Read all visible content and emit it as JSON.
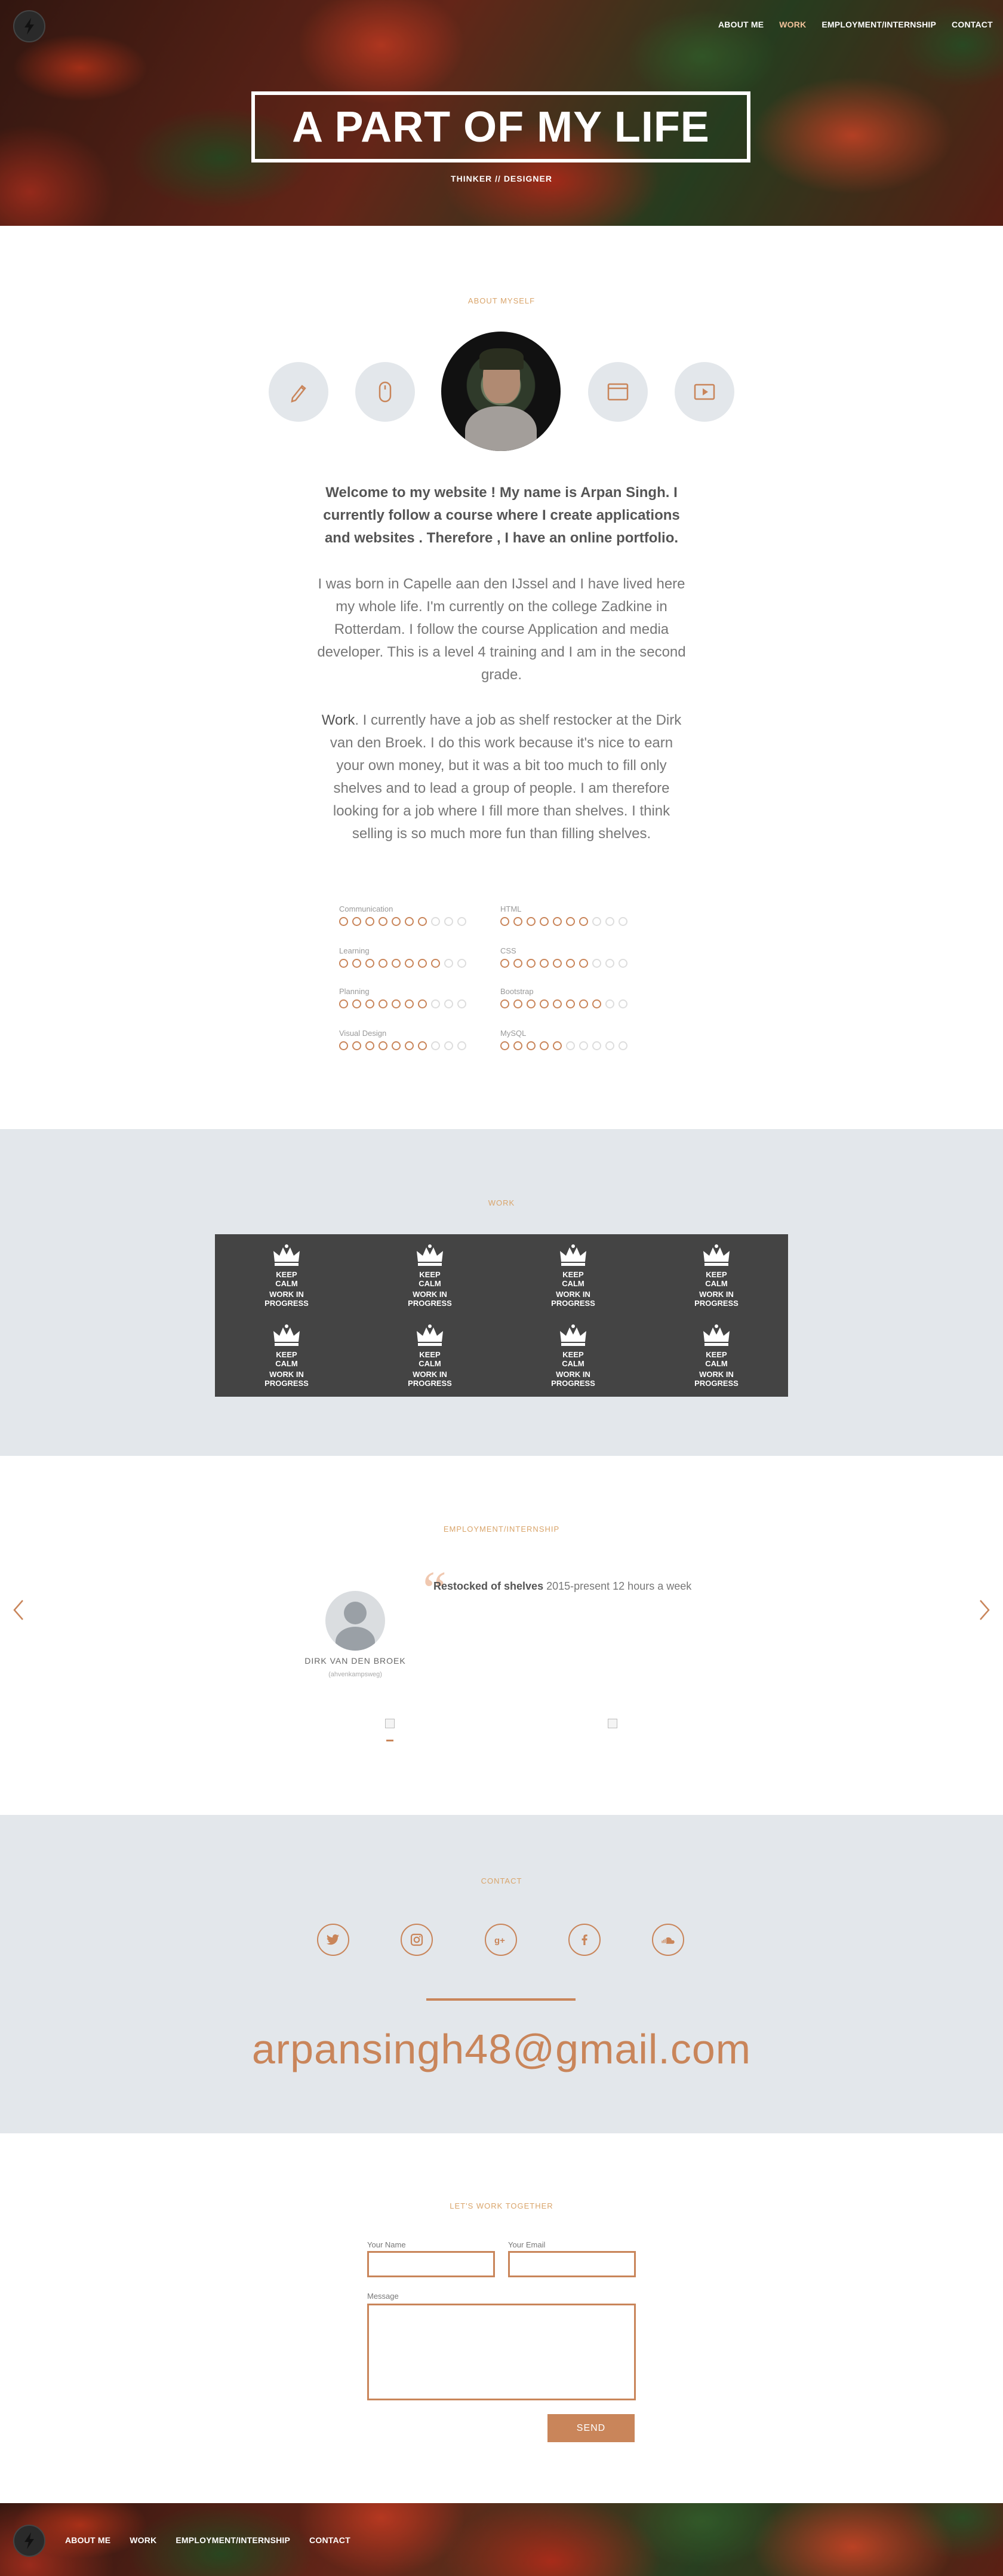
{
  "nav": {
    "items": [
      {
        "label": "ABOUT ME",
        "active": false
      },
      {
        "label": "WORK",
        "active": true
      },
      {
        "label": "EMPLOYMENT/INTERNSHIP",
        "active": false
      },
      {
        "label": "CONTACT",
        "active": false
      }
    ]
  },
  "footer_nav": {
    "items": [
      {
        "label": "ABOUT ME"
      },
      {
        "label": "WORK"
      },
      {
        "label": "EMPLOYMENT/INTERNSHIP"
      },
      {
        "label": "CONTACT"
      }
    ]
  },
  "hero": {
    "title": "A PART OF MY LIFE",
    "tagline": "THINKER // DESIGNER"
  },
  "about": {
    "section_title": "ABOUT MYSELF",
    "icons": [
      "pencil-icon",
      "mouse-icon",
      "browser-window-icon",
      "video-play-icon"
    ],
    "lead": "Welcome to my website ! My name is Arpan Singh. I currently follow a course where I create applications and websites . Therefore , I have an online portfolio.",
    "paragraph1": "I was born in Capelle aan den IJssel and I have lived here my whole life. I'm currently on the college Zadkine in Rotterdam. I follow the course Application and media developer. This is a level 4 training and I am in the second grade.",
    "paragraph2_bold": "Work",
    "paragraph2": ". I currently have a job as shelf restocker at the Dirk van den Broek. I do this work because it's nice to earn your own money, but it was a bit too much to fill only shelves and to lead a group of people. I am therefore looking for a job where I fill more than shelves. I think selling is so much more fun than filling shelves."
  },
  "skills": [
    {
      "name": "Communication",
      "level": 7,
      "max": 10
    },
    {
      "name": "HTML",
      "level": 7,
      "max": 10
    },
    {
      "name": "Learning",
      "level": 8,
      "max": 10
    },
    {
      "name": "CSS",
      "level": 7,
      "max": 10
    },
    {
      "name": "Planning",
      "level": 7,
      "max": 10
    },
    {
      "name": "Bootstrap",
      "level": 8,
      "max": 10
    },
    {
      "name": "Visual Design",
      "level": 7,
      "max": 10
    },
    {
      "name": "MySQL",
      "level": 5,
      "max": 10
    }
  ],
  "work": {
    "section_title": "WORK",
    "tiles": [
      {
        "line1": "KEEP",
        "line2": "CALM",
        "line3": "WORK IN",
        "line4": "PROGRESS"
      },
      {
        "line1": "KEEP",
        "line2": "CALM",
        "line3": "WORK IN",
        "line4": "PROGRESS"
      },
      {
        "line1": "KEEP",
        "line2": "CALM",
        "line3": "WORK IN",
        "line4": "PROGRESS"
      },
      {
        "line1": "KEEP",
        "line2": "CALM",
        "line3": "WORK IN",
        "line4": "PROGRESS"
      },
      {
        "line1": "KEEP",
        "line2": "CALM",
        "line3": "WORK IN",
        "line4": "PROGRESS"
      },
      {
        "line1": "KEEP",
        "line2": "CALM",
        "line3": "WORK IN",
        "line4": "PROGRESS"
      },
      {
        "line1": "KEEP",
        "line2": "CALM",
        "line3": "WORK IN",
        "line4": "PROGRESS"
      },
      {
        "line1": "KEEP",
        "line2": "CALM",
        "line3": "WORK IN",
        "line4": "PROGRESS"
      }
    ]
  },
  "employment": {
    "section_title": "EMPLOYMENT/INTERNSHIP",
    "quote_bold": "Restocked of shelves",
    "quote_rest": " 2015-present 12 hours a week",
    "name": "DIRK VAN DEN BROEK",
    "subtitle": "(ahvenkampsweg)"
  },
  "contact": {
    "section_title": "CONTACT",
    "socials": [
      "twitter-icon",
      "instagram-icon",
      "google-plus-icon",
      "facebook-icon",
      "soundcloud-icon"
    ],
    "email": "arpansingh48@gmail.com"
  },
  "form": {
    "section_title": "LET'S WORK TOGETHER",
    "name_label": "Your Name",
    "email_label": "Your Email",
    "message_label": "Message",
    "send_label": "SEND"
  },
  "colors": {
    "accent": "#c9855a",
    "section_title": "#d9a46a",
    "light_bg": "#e3e7eb",
    "work_grid_bg": "#444444"
  }
}
